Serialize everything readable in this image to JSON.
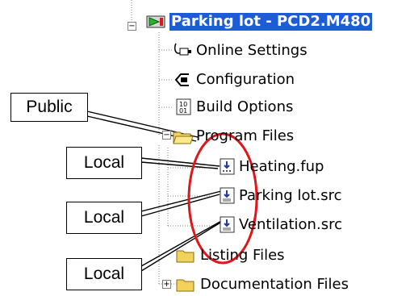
{
  "tree": {
    "root_label": "Parking lot - PCD2.M480",
    "items": [
      {
        "label": "Online Settings",
        "icon": "online-settings-icon"
      },
      {
        "label": "Configuration",
        "icon": "configuration-icon"
      },
      {
        "label": "Build Options",
        "icon": "build-options-icon"
      },
      {
        "label": "Program Files",
        "icon": "folder-open-icon"
      },
      {
        "label": "Heating.fup",
        "icon": "fupla-file-icon"
      },
      {
        "label": "Parking lot.src",
        "icon": "source-file-icon"
      },
      {
        "label": "Ventilation.src",
        "icon": "source-file-icon"
      },
      {
        "label": "Listing Files",
        "icon": "folder-icon"
      },
      {
        "label": "Documentation Files",
        "icon": "folder-icon"
      }
    ]
  },
  "callouts": {
    "public": "Public",
    "local_1": "Local",
    "local_2": "Local",
    "local_3": "Local"
  },
  "colors": {
    "selection": "#1e5bd6",
    "highlight_ellipse": "#e0161b",
    "folder": "#f2d25a"
  }
}
